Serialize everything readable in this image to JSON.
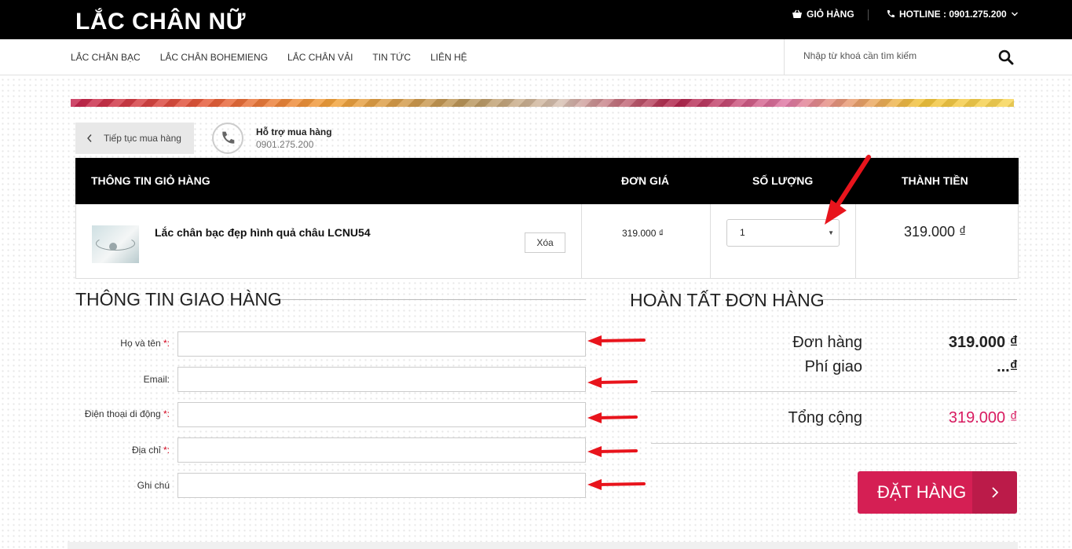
{
  "header": {
    "logo": "LẮC CHÂN NỮ",
    "cart_label": "GIỎ HÀNG",
    "hotline_label": "HOTLINE : 0901.275.200"
  },
  "nav": {
    "items": [
      "LẮC CHÂN BẠC",
      "LẮC CHÂN BOHEMIENG",
      "LẮC CHÂN VẢI",
      "TIN TỨC",
      "LIÊN HỆ"
    ]
  },
  "search": {
    "placeholder": "Nhập từ khoá cần tìm kiếm"
  },
  "toolbar": {
    "continue_label": "Tiếp tục mua hàng",
    "support_title": "Hỗ trợ mua hàng",
    "support_phone": "0901.275.200"
  },
  "cart": {
    "headers": {
      "info": "THÔNG TIN GIỎ HÀNG",
      "price": "ĐƠN GIÁ",
      "qty": "SỐ LƯỢNG",
      "total": "THÀNH TIỀN"
    },
    "item": {
      "name": "Lắc chân bạc đẹp hình quả châu LCNU54",
      "delete_label": "Xóa",
      "unit_price": "319.000 ₫",
      "quantity": "1",
      "line_total": "319.000 ₫"
    }
  },
  "shipping": {
    "title": "THÔNG TIN GIAO HÀNG",
    "required_mark": "*:",
    "fields": {
      "name": "Họ và tên ",
      "email": "Email:",
      "phone": "Điện thoại di động ",
      "address": "Địa chỉ ",
      "note": "Ghi chú"
    }
  },
  "summary": {
    "title": "HOÀN TẤT ĐƠN HÀNG",
    "order_label": "Đơn hàng",
    "order_value": "319.000 ₫",
    "ship_label": "Phí giao",
    "ship_value": "...₫",
    "total_label": "Tổng cộng",
    "total_value": "319.000 ₫",
    "submit_label": "ĐẶT HÀNG"
  },
  "colors": {
    "accent": "#d51f54",
    "price_pink": "#d81b60",
    "annotation_arrow": "#e8141c"
  }
}
